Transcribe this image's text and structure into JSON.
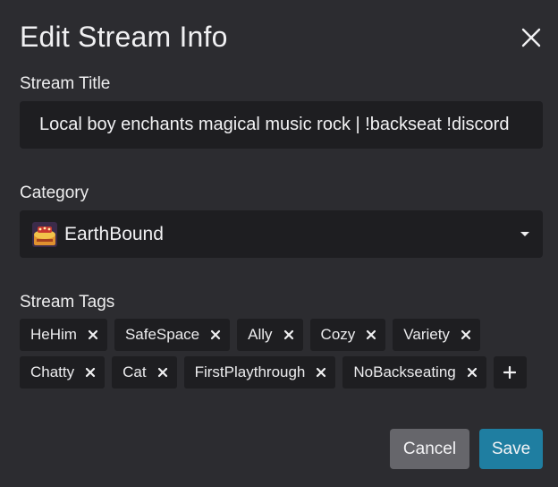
{
  "dialog": {
    "title": "Edit Stream Info",
    "close_icon": "close-icon"
  },
  "stream_title": {
    "label": "Stream Title",
    "value": "Local boy enchants magical music rock | !backseat !discord"
  },
  "category": {
    "label": "Category",
    "value": "EarthBound",
    "icon": "earthbound-game-icon"
  },
  "tags": {
    "label": "Stream Tags",
    "row1": [
      "HeHim",
      "SafeSpace",
      "Ally",
      "Cozy",
      "Variety"
    ],
    "row2": [
      "Chatty",
      "Cat",
      "FirstPlaythrough",
      "NoBackseating"
    ],
    "add_label": "+"
  },
  "actions": {
    "cancel_label": "Cancel",
    "save_label": "Save"
  },
  "colors": {
    "background": "#2c2c30",
    "field": "#1e1e21",
    "cancel": "#66666b",
    "save": "#1f7ea1"
  }
}
